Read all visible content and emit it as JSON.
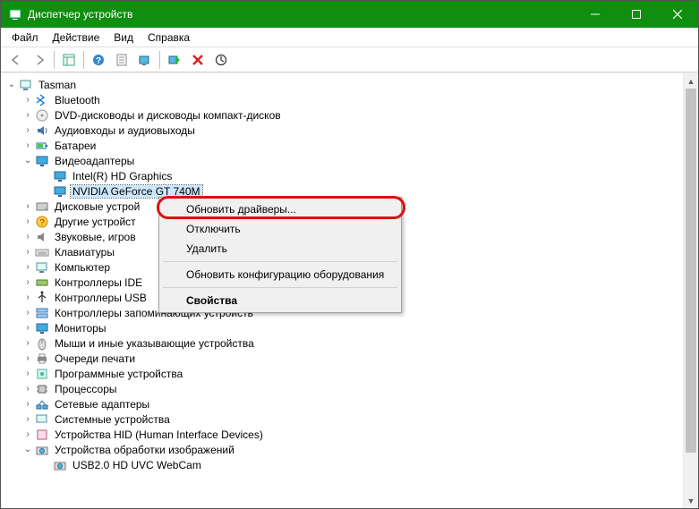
{
  "window": {
    "title": "Диспетчер устройств"
  },
  "menubar": [
    "Файл",
    "Действие",
    "Вид",
    "Справка"
  ],
  "toolbar_icons": [
    "back-icon",
    "forward-icon",
    "up-tree-icon",
    "sep",
    "help-icon",
    "details-icon",
    "monitor-icon",
    "sep",
    "scan-icon",
    "delete-icon",
    "update-icon"
  ],
  "tree": {
    "root": {
      "label": "Tasman",
      "expanded": true
    },
    "items": [
      {
        "label": "Bluetooth",
        "icon": "bluetooth-icon",
        "expander": ">"
      },
      {
        "label": "DVD-дисководы и дисководы компакт-дисков",
        "icon": "disc-icon",
        "expander": ">"
      },
      {
        "label": "Аудиовходы и аудиовыходы",
        "icon": "audio-icon",
        "expander": ">"
      },
      {
        "label": "Батареи",
        "icon": "battery-icon",
        "expander": ">"
      },
      {
        "label": "Видеоадаптеры",
        "icon": "display-icon",
        "expander": "v",
        "children": [
          {
            "label": "Intel(R) HD Graphics",
            "icon": "display-icon"
          },
          {
            "label": "NVIDIA GeForce GT 740M",
            "icon": "display-icon",
            "selected": true
          }
        ]
      },
      {
        "label": "Дисковые устрой",
        "icon": "disk-icon",
        "expander": ">"
      },
      {
        "label": "Другие устройст",
        "icon": "other-icon",
        "expander": ">"
      },
      {
        "label": "Звуковые, игров",
        "icon": "sound-icon",
        "expander": ">"
      },
      {
        "label": "Клавиатуры",
        "icon": "keyboard-icon",
        "expander": ">"
      },
      {
        "label": "Компьютер",
        "icon": "computer-icon",
        "expander": ">"
      },
      {
        "label": "Контроллеры IDE",
        "icon": "ide-icon",
        "expander": ">"
      },
      {
        "label": "Контроллеры USB",
        "icon": "usb-icon",
        "expander": ">"
      },
      {
        "label": "Контроллеры запоминающих устройств",
        "icon": "storage-icon",
        "expander": ">"
      },
      {
        "label": "Мониторы",
        "icon": "monitor-icon",
        "expander": ">"
      },
      {
        "label": "Мыши и иные указывающие устройства",
        "icon": "mouse-icon",
        "expander": ">"
      },
      {
        "label": "Очереди печати",
        "icon": "print-icon",
        "expander": ">"
      },
      {
        "label": "Программные устройства",
        "icon": "software-icon",
        "expander": ">"
      },
      {
        "label": "Процессоры",
        "icon": "cpu-icon",
        "expander": ">"
      },
      {
        "label": "Сетевые адаптеры",
        "icon": "network-icon",
        "expander": ">"
      },
      {
        "label": "Системные устройства",
        "icon": "system-icon",
        "expander": ">"
      },
      {
        "label": "Устройства HID (Human Interface Devices)",
        "icon": "hid-icon",
        "expander": ">"
      },
      {
        "label": "Устройства обработки изображений",
        "icon": "imaging-icon",
        "expander": "v",
        "children": [
          {
            "label": "USB2.0 HD UVC WebCam",
            "icon": "camera-icon"
          }
        ]
      }
    ]
  },
  "context_menu": {
    "items": [
      {
        "label": "Обновить драйверы...",
        "highlight": true
      },
      {
        "label": "Отключить"
      },
      {
        "label": "Удалить"
      },
      {
        "sep": true
      },
      {
        "label": "Обновить конфигурацию оборудования"
      },
      {
        "sep": true
      },
      {
        "label": "Свойства",
        "bold": true
      }
    ]
  }
}
